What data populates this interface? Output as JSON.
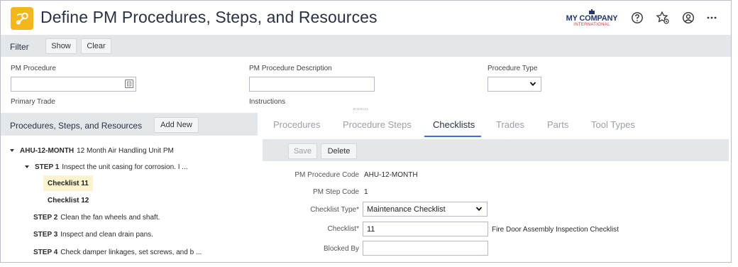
{
  "header": {
    "title": "Define PM Procedures, Steps, and Resources",
    "app_icon": "wrench-icon",
    "logo": {
      "line1": "MY COMPANY",
      "line2": "INTERNATIONAL"
    },
    "icons": [
      "help-icon",
      "favorites-settings-icon",
      "user-icon",
      "more-icon"
    ]
  },
  "filter": {
    "label": "Filter",
    "show_label": "Show",
    "clear_label": "Clear",
    "fields": {
      "pm_procedure": {
        "label": "PM Procedure",
        "value": ""
      },
      "pm_procedure_description": {
        "label": "PM Procedure Description",
        "value": ""
      },
      "procedure_type": {
        "label": "Procedure Type",
        "value": ""
      },
      "primary_trade": {
        "label": "Primary Trade"
      },
      "instructions": {
        "label": "Instructions"
      }
    }
  },
  "tree_panel": {
    "title": "Procedures, Steps, and Resources",
    "add_new_label": "Add New",
    "procedure": {
      "code": "AHU-12-MONTH",
      "description": "12 Month Air Handling Unit PM"
    },
    "steps": [
      {
        "code": "STEP 1",
        "description": "Inspect the unit casing for corrosion. I ..."
      },
      {
        "code": "STEP 2",
        "description": "Clean the fan wheels and shaft."
      },
      {
        "code": "STEP 3",
        "description": "Inspect and clean drain pans."
      },
      {
        "code": "STEP 4",
        "description": "Check damper linkages, set screws, and b ..."
      }
    ],
    "checklists": [
      "Checklist 11",
      "Checklist 12"
    ]
  },
  "tabs": [
    "Procedures",
    "Procedure Steps",
    "Checklists",
    "Trades",
    "Parts",
    "Tool Types"
  ],
  "active_tab": "Checklists",
  "toolbar": {
    "save_label": "Save",
    "delete_label": "Delete"
  },
  "form": {
    "pm_procedure_code": {
      "label": "PM Procedure Code",
      "value": "AHU-12-MONTH"
    },
    "pm_step_code": {
      "label": "PM Step Code",
      "value": "1"
    },
    "checklist_type": {
      "label": "Checklist Type*",
      "value": "Maintenance Checklist"
    },
    "checklist": {
      "label": "Checklist*",
      "value": "11",
      "description": "Fire Door Assembly Inspection Checklist"
    },
    "blocked_by": {
      "label": "Blocked By",
      "value": ""
    }
  },
  "colors": {
    "accent_yellow": "#f3b71c",
    "tab_active_underline": "#3b6fd6",
    "panel_gray": "#e4e7ea",
    "selected_row": "#fdf3cf"
  }
}
